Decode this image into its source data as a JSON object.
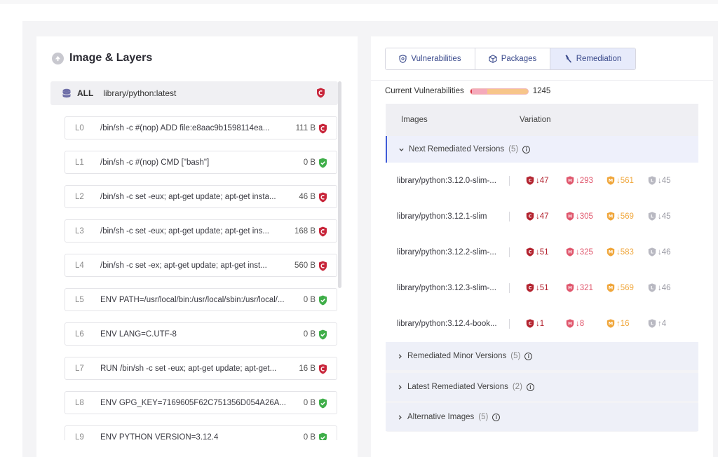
{
  "left": {
    "title": "Image & Layers",
    "all_row": {
      "label": "ALL",
      "image": "library/python:latest"
    },
    "layers": [
      {
        "id": "L0",
        "cmd": "/bin/sh -c #(nop) ADD file:e8aac9b1598114ea...",
        "size": "111 B",
        "status": "vuln"
      },
      {
        "id": "L1",
        "cmd": "/bin/sh -c #(nop) CMD [\"bash\"]",
        "size": "0 B",
        "status": "ok"
      },
      {
        "id": "L2",
        "cmd": "/bin/sh -c set -eux; apt-get update; apt-get insta...",
        "size": "46 B",
        "status": "vuln"
      },
      {
        "id": "L3",
        "cmd": "/bin/sh -c set -eux; apt-get update; apt-get ins...",
        "size": "168 B",
        "status": "vuln"
      },
      {
        "id": "L4",
        "cmd": "/bin/sh -c set -ex; apt-get update; apt-get inst...",
        "size": "560 B",
        "status": "vuln"
      },
      {
        "id": "L5",
        "cmd": "ENV PATH=/usr/local/bin:/usr/local/sbin:/usr/local/...",
        "size": "0 B",
        "status": "ok"
      },
      {
        "id": "L6",
        "cmd": "ENV LANG=C.UTF-8",
        "size": "0 B",
        "status": "ok"
      },
      {
        "id": "L7",
        "cmd": "RUN /bin/sh -c set -eux; apt-get update; apt-get...",
        "size": "16 B",
        "status": "vuln"
      },
      {
        "id": "L8",
        "cmd": "ENV GPG_KEY=7169605F62C751356D054A26A...",
        "size": "0 B",
        "status": "ok"
      },
      {
        "id": "L9",
        "cmd": "ENV PYTHON VERSION=3.12.4",
        "size": "0 B",
        "status": "ok"
      }
    ]
  },
  "right": {
    "tabs": [
      "Vulnerabilities",
      "Packages",
      "Remediation"
    ],
    "current_vulns_label": "Current Vulnerabilities",
    "current_vulns_count": "1245",
    "table_headers": {
      "images": "Images",
      "variation": "Variation"
    },
    "open_group": {
      "label": "Next Remediated Versions",
      "count": "(5)"
    },
    "rows": [
      {
        "image": "library/python:3.12.0-slim-...",
        "crit": "↓47",
        "high": "↓293",
        "med": "↓561",
        "low": "↓45"
      },
      {
        "image": "library/python:3.12.1-slim",
        "crit": "↓47",
        "high": "↓305",
        "med": "↓569",
        "low": "↓45"
      },
      {
        "image": "library/python:3.12.2-slim-...",
        "crit": "↓51",
        "high": "↓325",
        "med": "↓583",
        "low": "↓46"
      },
      {
        "image": "library/python:3.12.3-slim-...",
        "crit": "↓51",
        "high": "↓321",
        "med": "↓569",
        "low": "↓46"
      },
      {
        "image": "library/python:3.12.4-book...",
        "crit": "↓1",
        "high": "↓8",
        "med": "↑16",
        "low": "↑4"
      }
    ],
    "collapsed_groups": [
      {
        "label": "Remediated Minor Versions",
        "count": "(5)"
      },
      {
        "label": "Latest Remediated Versions",
        "count": "(2)"
      },
      {
        "label": "Alternative Images",
        "count": "(5)"
      }
    ]
  },
  "colors": {
    "critical": "#b3232f",
    "high": "#e0576d",
    "medium": "#f0a63a",
    "low": "#9a9aa4",
    "ok": "#3fae49",
    "accent": "#3f5bd8"
  }
}
